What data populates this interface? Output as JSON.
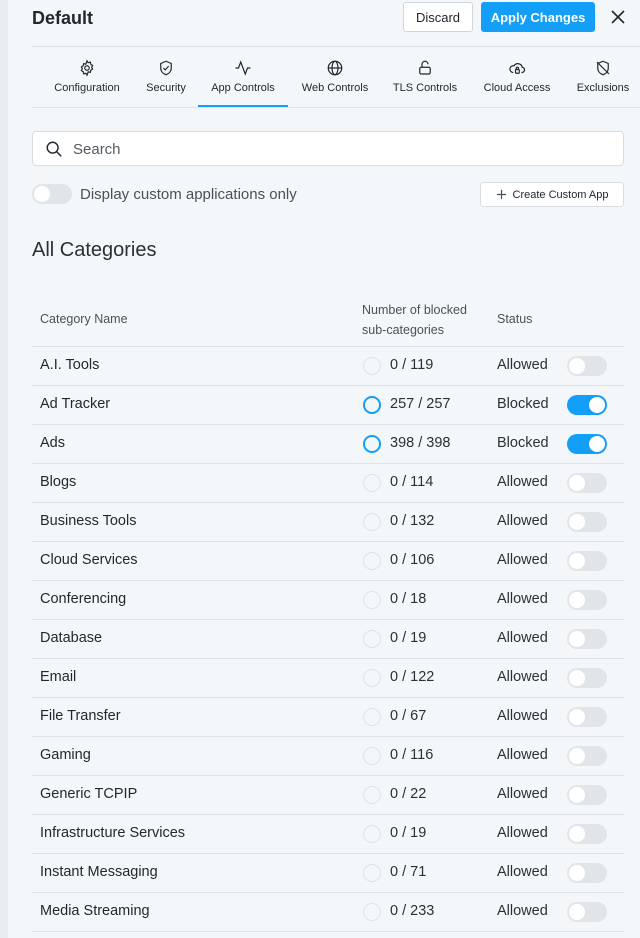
{
  "header": {
    "title": "Default",
    "discard_label": "Discard",
    "apply_label": "Apply Changes",
    "close_icon": "close-icon"
  },
  "tabs": [
    {
      "label": "Configuration",
      "icon": "gear-icon",
      "active": false
    },
    {
      "label": "Security",
      "icon": "shield-check-icon",
      "active": false
    },
    {
      "label": "App Controls",
      "icon": "activity-icon",
      "active": true
    },
    {
      "label": "Web Controls",
      "icon": "globe-icon",
      "active": false
    },
    {
      "label": "TLS Controls",
      "icon": "lock-icon",
      "active": false
    },
    {
      "label": "Cloud Access",
      "icon": "cloud-lock-icon",
      "active": false
    },
    {
      "label": "Exclusions",
      "icon": "shield-off-icon",
      "active": false
    }
  ],
  "search": {
    "placeholder": "Search",
    "value": ""
  },
  "custom_toggle": {
    "label": "Display custom applications only",
    "on": false
  },
  "create_button": {
    "label": "Create Custom App"
  },
  "section": {
    "title": "All Categories"
  },
  "table": {
    "columns": {
      "name": "Category Name",
      "count": "Number of blocked sub-categories",
      "status": "Status"
    },
    "rows": [
      {
        "name": "A.I. Tools",
        "count": "0 / 119",
        "status": "Allowed",
        "blocked": false
      },
      {
        "name": "Ad Tracker",
        "count": "257 / 257",
        "status": "Blocked",
        "blocked": true
      },
      {
        "name": "Ads",
        "count": "398 / 398",
        "status": "Blocked",
        "blocked": true
      },
      {
        "name": "Blogs",
        "count": "0 / 114",
        "status": "Allowed",
        "blocked": false
      },
      {
        "name": "Business Tools",
        "count": "0 / 132",
        "status": "Allowed",
        "blocked": false
      },
      {
        "name": "Cloud Services",
        "count": "0 / 106",
        "status": "Allowed",
        "blocked": false
      },
      {
        "name": "Conferencing",
        "count": "0 / 18",
        "status": "Allowed",
        "blocked": false
      },
      {
        "name": "Database",
        "count": "0 / 19",
        "status": "Allowed",
        "blocked": false
      },
      {
        "name": "Email",
        "count": "0 / 122",
        "status": "Allowed",
        "blocked": false
      },
      {
        "name": "File Transfer",
        "count": "0 / 67",
        "status": "Allowed",
        "blocked": false
      },
      {
        "name": "Gaming",
        "count": "0 / 116",
        "status": "Allowed",
        "blocked": false
      },
      {
        "name": "Generic TCPIP",
        "count": "0 / 22",
        "status": "Allowed",
        "blocked": false
      },
      {
        "name": "Infrastructure Services",
        "count": "0 / 19",
        "status": "Allowed",
        "blocked": false
      },
      {
        "name": "Instant Messaging",
        "count": "0 / 71",
        "status": "Allowed",
        "blocked": false
      },
      {
        "name": "Media Streaming",
        "count": "0 / 233",
        "status": "Allowed",
        "blocked": false
      }
    ]
  },
  "colors": {
    "accent": "#139ef7",
    "background": "#f4f7fa"
  }
}
